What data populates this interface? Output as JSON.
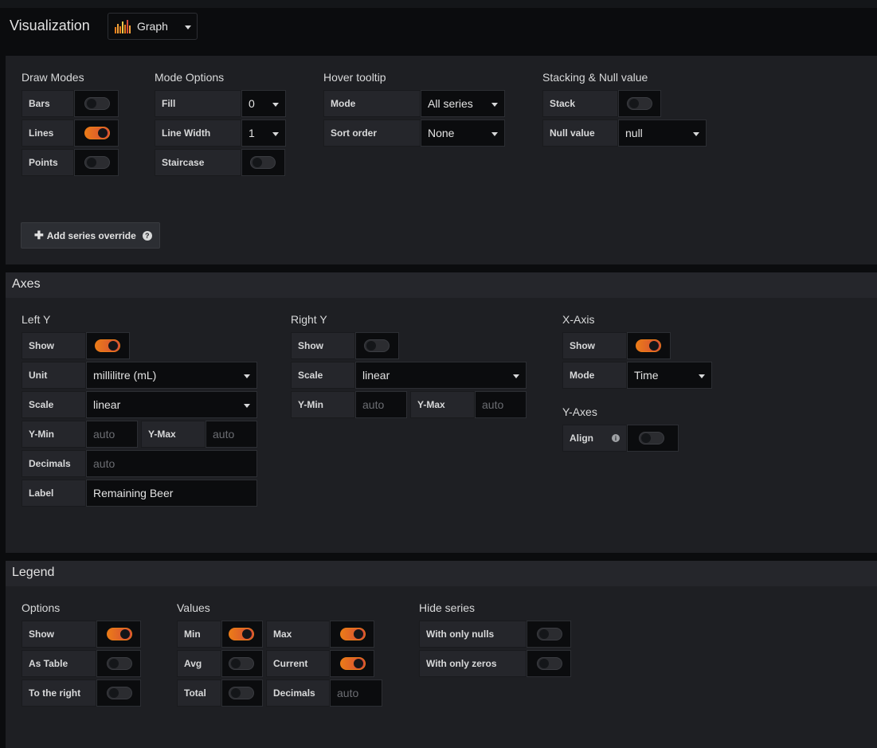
{
  "visualization": {
    "title": "Visualization",
    "picker_label": "Graph",
    "icon": "bar-chart-icon"
  },
  "draw": {
    "draw_modes": {
      "title": "Draw Modes",
      "bars": "Bars",
      "lines": "Lines",
      "points": "Points",
      "bars_on": false,
      "lines_on": true,
      "points_on": false
    },
    "mode_options": {
      "title": "Mode Options",
      "fill_label": "Fill",
      "fill_value": "0",
      "line_width_label": "Line Width",
      "line_width_value": "1",
      "staircase_label": "Staircase",
      "staircase_on": false
    },
    "hover": {
      "title": "Hover tooltip",
      "mode_label": "Mode",
      "mode_value": "All series",
      "sort_label": "Sort order",
      "sort_value": "None"
    },
    "stacking": {
      "title": "Stacking & Null value",
      "stack_label": "Stack",
      "stack_on": false,
      "null_label": "Null value",
      "null_value": "null"
    },
    "add_override": "Add series override"
  },
  "axes": {
    "header": "Axes",
    "left_y": {
      "title": "Left Y",
      "show_label": "Show",
      "show_on": true,
      "unit_label": "Unit",
      "unit_value": "millilitre (mL)",
      "scale_label": "Scale",
      "scale_value": "linear",
      "ymin_label": "Y-Min",
      "ymin_ph": "auto",
      "ymax_label": "Y-Max",
      "ymax_ph": "auto",
      "decimals_label": "Decimals",
      "decimals_ph": "auto",
      "label_label": "Label",
      "label_value": "Remaining Beer"
    },
    "right_y": {
      "title": "Right Y",
      "show_label": "Show",
      "show_on": false,
      "scale_label": "Scale",
      "scale_value": "linear",
      "ymin_label": "Y-Min",
      "ymin_ph": "auto",
      "ymax_label": "Y-Max",
      "ymax_ph": "auto"
    },
    "x_axis": {
      "title": "X-Axis",
      "show_label": "Show",
      "show_on": true,
      "mode_label": "Mode",
      "mode_value": "Time"
    },
    "y_axes": {
      "title": "Y-Axes",
      "align_label": "Align",
      "align_on": false
    }
  },
  "legend": {
    "header": "Legend",
    "options": {
      "title": "Options",
      "show_label": "Show",
      "show_on": true,
      "as_table_label": "As Table",
      "as_table_on": false,
      "right_label": "To the right",
      "right_on": false
    },
    "values": {
      "title": "Values",
      "min_label": "Min",
      "min_on": true,
      "max_label": "Max",
      "max_on": true,
      "avg_label": "Avg",
      "avg_on": false,
      "current_label": "Current",
      "current_on": true,
      "total_label": "Total",
      "total_on": false,
      "decimals_label": "Decimals",
      "decimals_ph": "auto"
    },
    "hide": {
      "title": "Hide series",
      "nulls_label": "With only nulls",
      "nulls_on": false,
      "zeros_label": "With only zeros",
      "zeros_on": false
    }
  },
  "colors": {
    "accent": "#eb7b18",
    "panel": "#1e1f23",
    "background": "#0b0c0e"
  }
}
